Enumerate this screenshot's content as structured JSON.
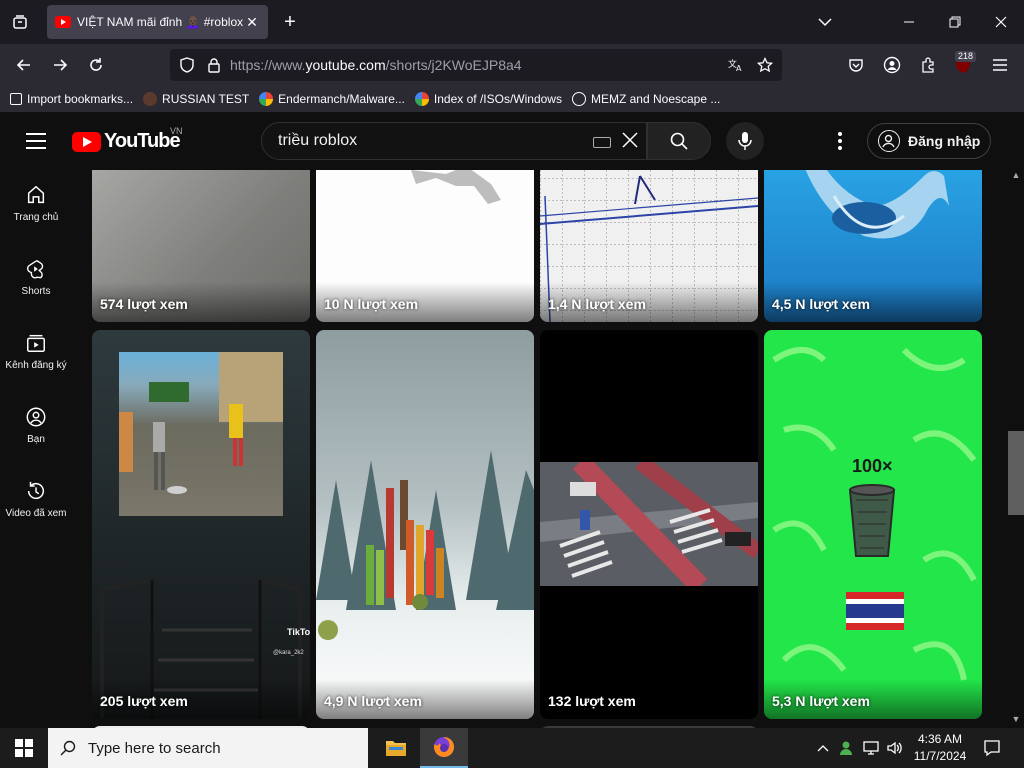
{
  "browser": {
    "tab_title": "VIỆT NAM mãi đỉnh 👩🏿‍🦲 #roblox",
    "url_prefix": "https://www.",
    "url_host": "youtube.com",
    "url_path": "/shorts/j2KWoEJP8a4",
    "extension_badge": "218",
    "bookmarks": [
      {
        "label": "Import bookmarks...",
        "icon": "import-icon"
      },
      {
        "label": "RUSSIAN TEST",
        "icon": "site-icon"
      },
      {
        "label": "Endermanch/Malware...",
        "icon": "google-icon"
      },
      {
        "label": "Index of /ISOs/Windows",
        "icon": "google-icon"
      },
      {
        "label": "MEMZ and Noescape ...",
        "icon": "globe-icon"
      }
    ]
  },
  "youtube": {
    "logo_text": "YouTube",
    "country_code": "VN",
    "search_value": "triều roblox",
    "signin_label": "Đăng nhập",
    "sidebar": [
      {
        "label": "Trang chủ",
        "icon": "home-icon"
      },
      {
        "label": "Shorts",
        "icon": "shorts-icon"
      },
      {
        "label": "Kênh đăng ký",
        "icon": "subscriptions-icon"
      },
      {
        "label": "Bạn",
        "icon": "you-icon"
      },
      {
        "label": "Video đã xem",
        "icon": "history-icon"
      }
    ],
    "row1_views": [
      "574 lượt xem",
      "10 N lượt xem",
      "1,4 N lượt xem",
      "4,5 N lượt xem"
    ],
    "row2_views": [
      "205 lượt xem",
      "4,9 N lượt xem",
      "132 lượt xem",
      "5,3 N lượt xem"
    ],
    "overlay_tiktok": "TikTok",
    "overlay_tiktok_user": "@kara_2k2",
    "overlay_100x": "100×"
  },
  "taskbar": {
    "search_placeholder": "Type here to search",
    "time": "4:36 AM",
    "date": "11/7/2024"
  },
  "colors": {
    "yt_red": "#ff0000",
    "bg": "#0f0f0f",
    "browser_tab": "#42414d",
    "browser_toolbar": "#2b2a33",
    "green_screen": "#22e64a"
  }
}
